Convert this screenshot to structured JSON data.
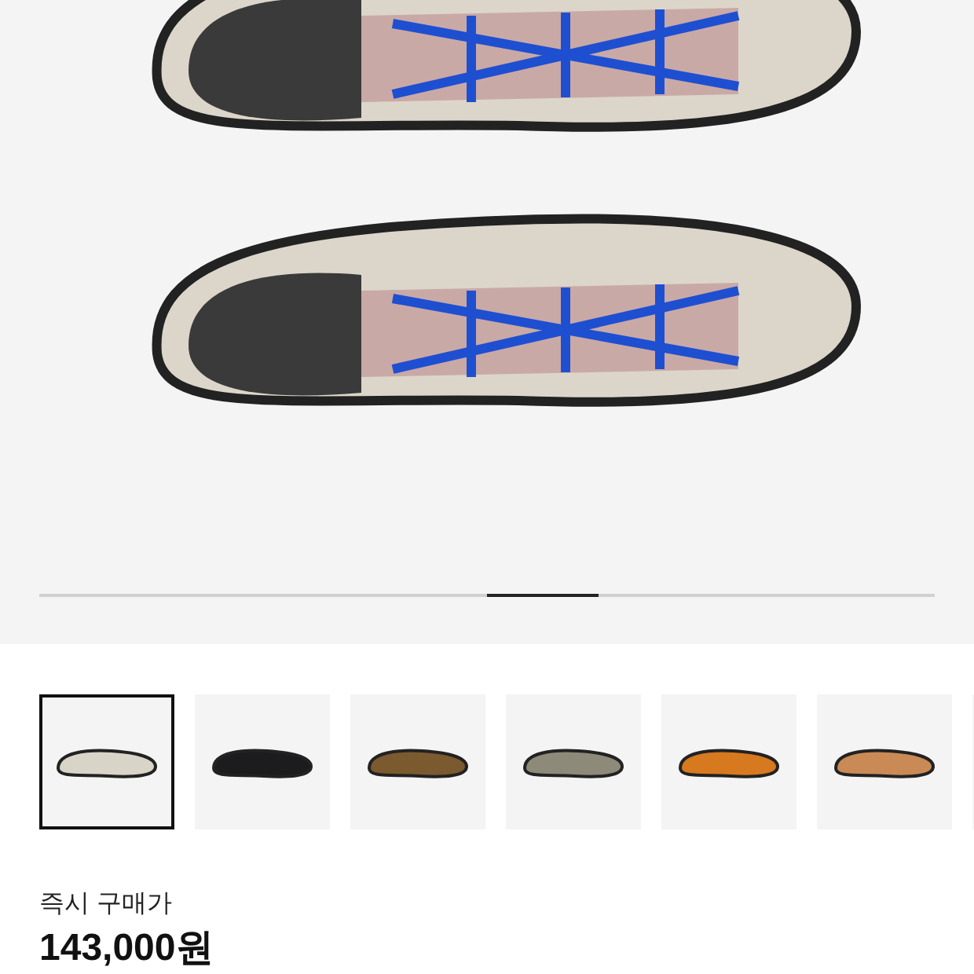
{
  "gallery": {
    "thumbnails": [
      {
        "selected": true,
        "color": "#d9d4c8"
      },
      {
        "selected": false,
        "color": "#1c1c1e"
      },
      {
        "selected": false,
        "color": "#7a5a2e"
      },
      {
        "selected": false,
        "color": "#8e8a7a"
      },
      {
        "selected": false,
        "color": "#d7791f"
      },
      {
        "selected": false,
        "color": "#c98a55"
      },
      {
        "selected": false
      }
    ]
  },
  "price": {
    "label": "즉시 구매가",
    "value": "143,000원"
  }
}
